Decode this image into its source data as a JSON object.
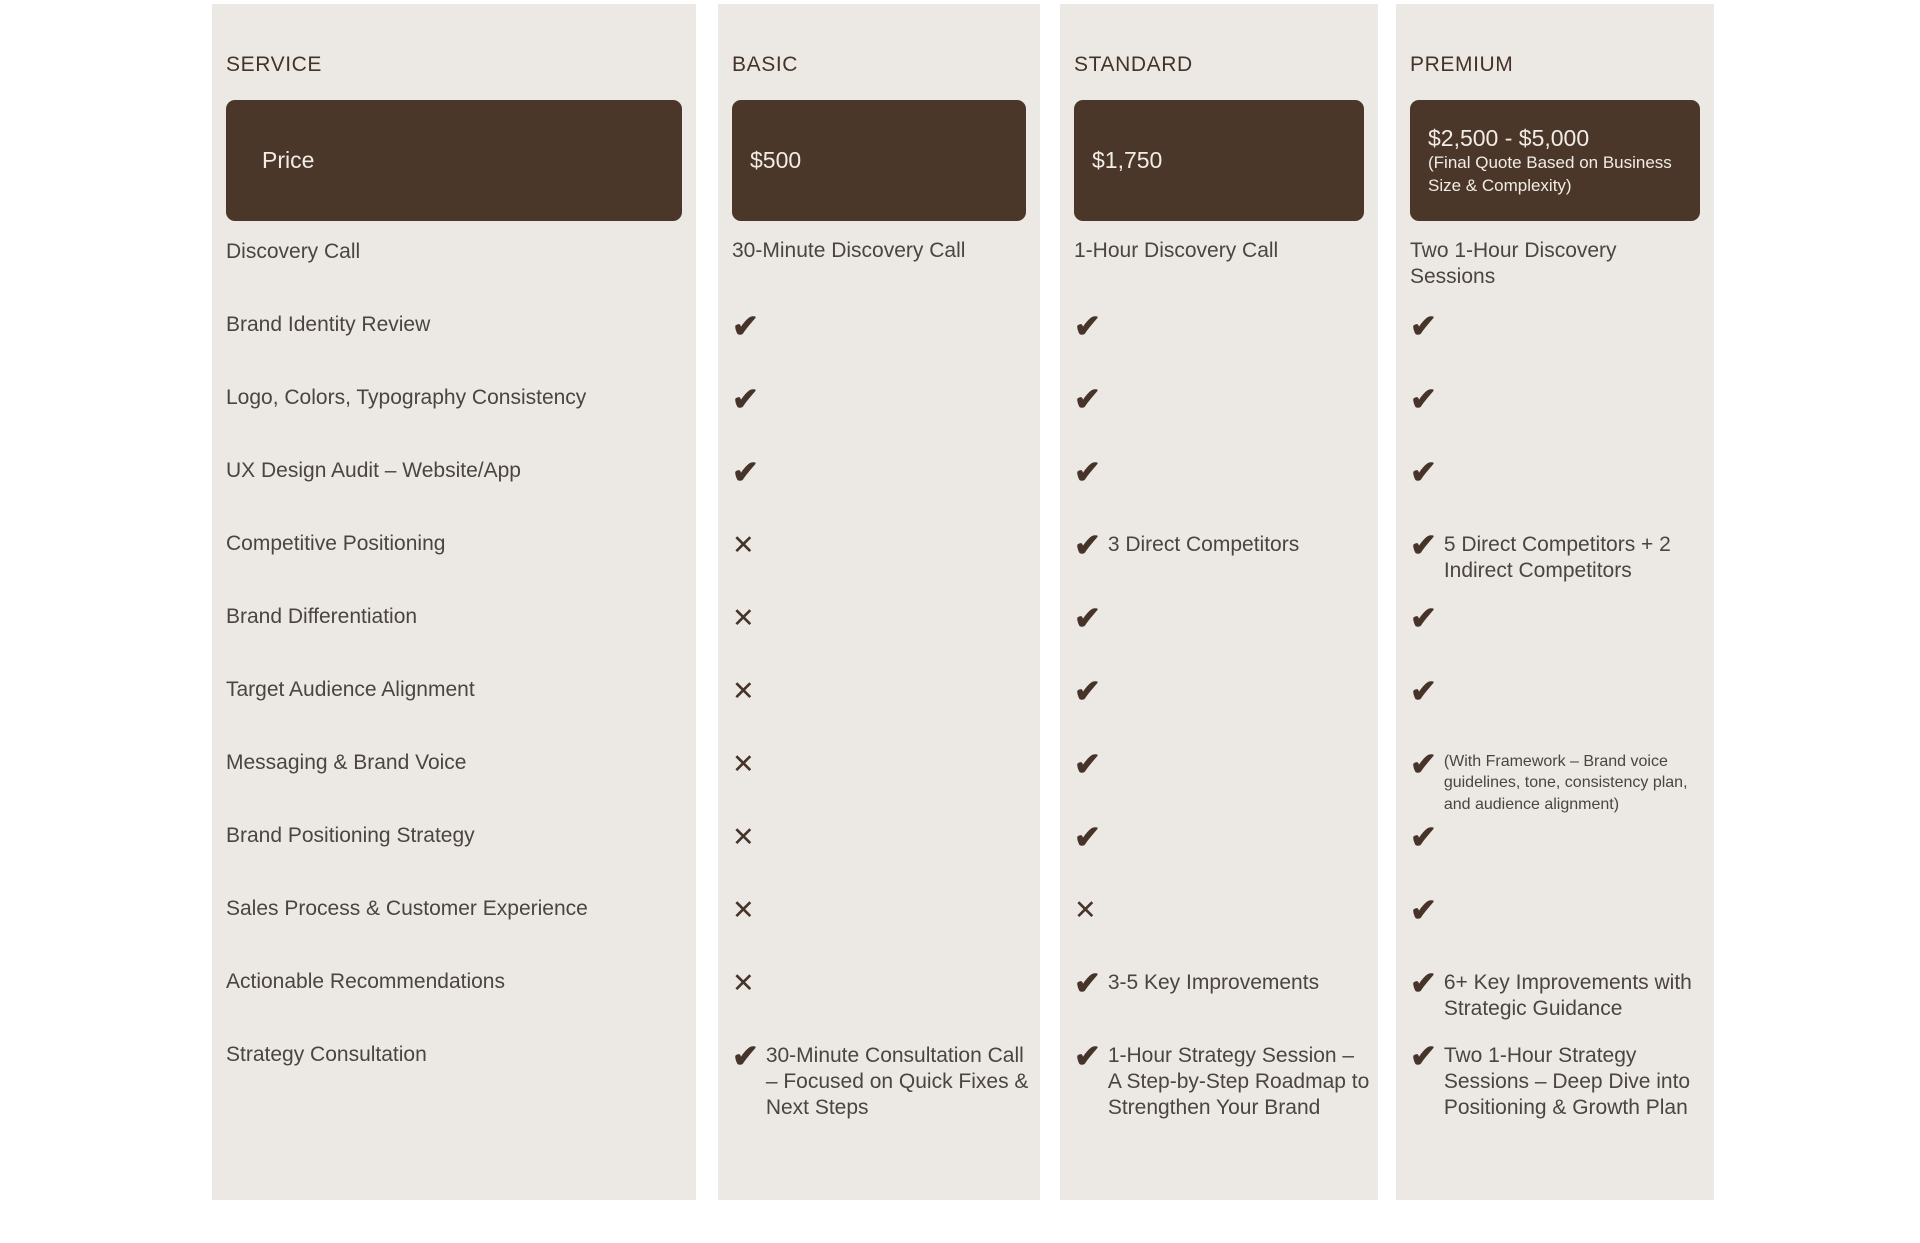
{
  "columns": [
    {
      "header": "SERVICE",
      "price_main": "Price",
      "price_sub": ""
    },
    {
      "header": "BASIC",
      "price_main": "$500",
      "price_sub": ""
    },
    {
      "header": "STANDARD",
      "price_main": "$1,750",
      "price_sub": ""
    },
    {
      "header": "PREMIUM",
      "price_main": "$2,500 - $5,000",
      "price_sub": "(Final Quote Based on Business Size & Complexity)"
    }
  ],
  "icons": {
    "check": "✔",
    "cross": "✕"
  },
  "colors": {
    "panel_bg": "#ece9e5",
    "price_bg": "#4b3729",
    "price_text": "#f2ece6",
    "body_text": "#4b4440",
    "header_text": "#463328",
    "page_bg": "#ffffff"
  },
  "rows": [
    {
      "service": "Discovery Call",
      "basic": {
        "mark": "",
        "text": "30-Minute Discovery Call"
      },
      "standard": {
        "mark": "",
        "text": "1-Hour Discovery Call"
      },
      "premium": {
        "mark": "",
        "text": "Two 1-Hour Discovery Sessions"
      }
    },
    {
      "service": "Brand Identity Review",
      "basic": {
        "mark": "check",
        "text": ""
      },
      "standard": {
        "mark": "check",
        "text": ""
      },
      "premium": {
        "mark": "check",
        "text": ""
      }
    },
    {
      "service": "Logo, Colors, Typography Consistency",
      "basic": {
        "mark": "check",
        "text": ""
      },
      "standard": {
        "mark": "check",
        "text": ""
      },
      "premium": {
        "mark": "check",
        "text": ""
      }
    },
    {
      "service": "UX Design Audit – Website/App",
      "basic": {
        "mark": "check",
        "text": ""
      },
      "standard": {
        "mark": "check",
        "text": ""
      },
      "premium": {
        "mark": "check",
        "text": ""
      }
    },
    {
      "service": "Competitive Positioning",
      "basic": {
        "mark": "cross",
        "text": ""
      },
      "standard": {
        "mark": "check",
        "text": "3 Direct Competitors"
      },
      "premium": {
        "mark": "check",
        "text": "5 Direct Competitors + 2 Indirect Competitors"
      }
    },
    {
      "service": "Brand Differentiation",
      "basic": {
        "mark": "cross",
        "text": ""
      },
      "standard": {
        "mark": "check",
        "text": ""
      },
      "premium": {
        "mark": "check",
        "text": ""
      }
    },
    {
      "service": "Target Audience Alignment",
      "basic": {
        "mark": "cross",
        "text": ""
      },
      "standard": {
        "mark": "check",
        "text": ""
      },
      "premium": {
        "mark": "check",
        "text": ""
      }
    },
    {
      "service": "Messaging & Brand Voice",
      "basic": {
        "mark": "cross",
        "text": ""
      },
      "standard": {
        "mark": "check",
        "text": ""
      },
      "premium": {
        "mark": "check",
        "text": "(With Framework – Brand voice guidelines, tone, consistency plan, and audience alignment)",
        "small": true
      }
    },
    {
      "service": "Brand Positioning Strategy",
      "basic": {
        "mark": "cross",
        "text": ""
      },
      "standard": {
        "mark": "check",
        "text": ""
      },
      "premium": {
        "mark": "check",
        "text": ""
      }
    },
    {
      "service": "Sales Process & Customer Experience",
      "basic": {
        "mark": "cross",
        "text": ""
      },
      "standard": {
        "mark": "cross",
        "text": ""
      },
      "premium": {
        "mark": "check",
        "text": ""
      }
    },
    {
      "service": "Actionable Recommendations",
      "basic": {
        "mark": "cross",
        "text": ""
      },
      "standard": {
        "mark": "check",
        "text": "3-5 Key Improvements"
      },
      "premium": {
        "mark": "check",
        "text": "6+ Key Improvements with Strategic Guidance"
      }
    },
    {
      "service": "Strategy Consultation",
      "basic": {
        "mark": "check",
        "text": "30-Minute Consultation Call – Focused on Quick Fixes & Next Steps"
      },
      "standard": {
        "mark": "check",
        "text": "1-Hour Strategy Session – A Step-by-Step Roadmap to Strengthen Your Brand"
      },
      "premium": {
        "mark": "check",
        "text": "Two 1-Hour Strategy Sessions – Deep Dive into Positioning & Growth Plan"
      }
    }
  ]
}
